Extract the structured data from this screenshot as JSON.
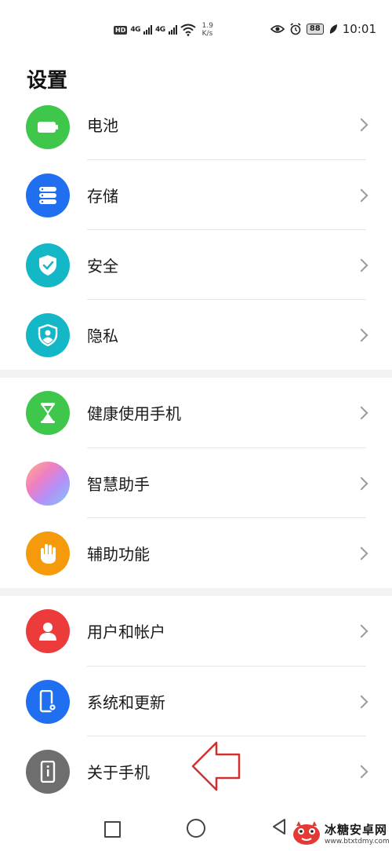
{
  "status_bar": {
    "hd": "HD",
    "sig1": "4G",
    "sig2": "4G",
    "speed_value": "1.9",
    "speed_unit": "K/s",
    "battery": "88",
    "time": "10:01"
  },
  "page": {
    "title": "设置"
  },
  "items": [
    {
      "label": "电池",
      "icon": "battery-icon",
      "color": "#3ec74b"
    },
    {
      "label": "存储",
      "icon": "storage-icon",
      "color": "#1f6ff0"
    },
    {
      "label": "安全",
      "icon": "shield-check-icon",
      "color": "#14b7c6"
    },
    {
      "label": "隐私",
      "icon": "privacy-shield-icon",
      "color": "#14b7c6"
    },
    {
      "label": "健康使用手机",
      "icon": "hourglass-icon",
      "color": "#3ec74b"
    },
    {
      "label": "智慧助手",
      "icon": "smart-assistant-icon",
      "color": "#c79cf0"
    },
    {
      "label": "辅助功能",
      "icon": "hand-icon",
      "color": "#f59a0b"
    },
    {
      "label": "用户和帐户",
      "icon": "user-icon",
      "color": "#ec3b3b"
    },
    {
      "label": "系统和更新",
      "icon": "system-update-icon",
      "color": "#1f6ff0"
    },
    {
      "label": "关于手机",
      "icon": "about-phone-icon",
      "color": "#6e6e6e"
    }
  ],
  "watermark": {
    "title": "冰糖安卓网",
    "url": "www.btxtdmy.com"
  }
}
